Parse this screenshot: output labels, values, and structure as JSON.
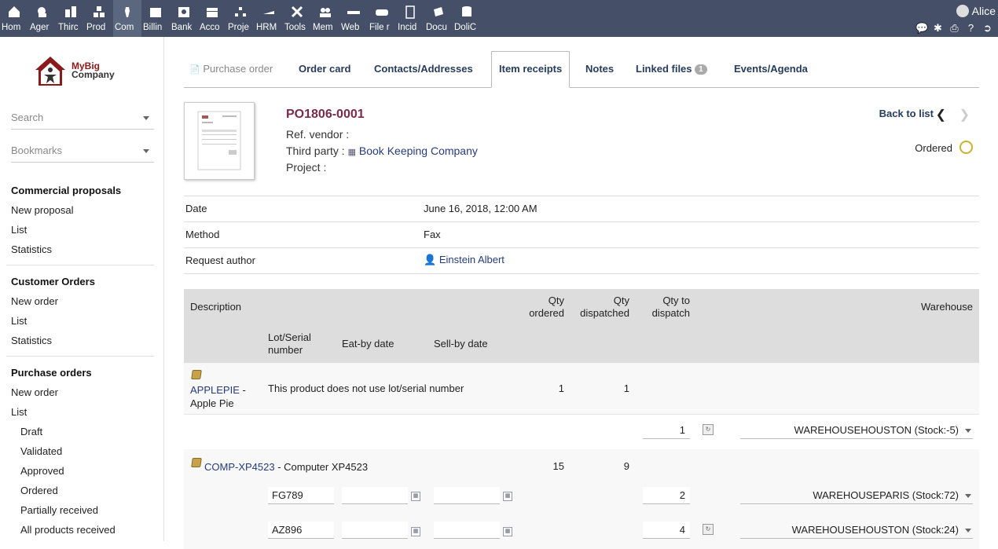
{
  "topmenu": {
    "items": [
      {
        "label": "Hom"
      },
      {
        "label": "Ager"
      },
      {
        "label": "Thirc"
      },
      {
        "label": "Prod"
      },
      {
        "label": "Com"
      },
      {
        "label": "Billin"
      },
      {
        "label": "Bank"
      },
      {
        "label": "Acco"
      },
      {
        "label": "Proje"
      },
      {
        "label": "HRM"
      },
      {
        "label": "Tools"
      },
      {
        "label": "Mem"
      },
      {
        "label": "Web"
      },
      {
        "label": "File r"
      },
      {
        "label": "Incid"
      },
      {
        "label": "Docu"
      },
      {
        "label": "DoliC"
      }
    ],
    "active_index": 4,
    "user": "Alice"
  },
  "sidebar": {
    "logo_line1": "MyBig",
    "logo_line2": "Company",
    "search_placeholder": "Search",
    "bookmarks_placeholder": "Bookmarks",
    "sections": [
      {
        "title": "Commercial proposals",
        "links": [
          "New proposal",
          "List",
          "Statistics"
        ]
      },
      {
        "title": "Customer Orders",
        "links": [
          "New order",
          "List",
          "Statistics"
        ]
      },
      {
        "title": "Purchase orders",
        "links": [
          "New order",
          "List"
        ],
        "sublinks": [
          "Draft",
          "Validated",
          "Approved",
          "Ordered",
          "Partially received",
          "All products received"
        ]
      }
    ]
  },
  "tabs": {
    "first": "Purchase order",
    "items": [
      "Order card",
      "Contacts/Addresses",
      "Item receipts",
      "Notes",
      "Linked files",
      "Events/Agenda"
    ],
    "linked_files_count": "1",
    "active": "Item receipts"
  },
  "header": {
    "ref": "PO1806-0001",
    "ref_vendor_label": "Ref. vendor :",
    "third_party_label": "Third party :",
    "third_party": "Book Keeping Company",
    "project_label": "Project :",
    "back_to_list": "Back to list",
    "status": "Ordered"
  },
  "info": {
    "date_label": "Date",
    "date_value": "June 16, 2018, 12:00 AM",
    "method_label": "Method",
    "method_value": "Fax",
    "author_label": "Request author",
    "author_value": "Einstein Albert"
  },
  "table": {
    "headers": {
      "description": "Description",
      "qty_ordered_1": "Qty",
      "qty_ordered_2": "ordered",
      "qty_dispatched_1": "Qty",
      "qty_dispatched_2": "dispatched",
      "qty_to_dispatch_1": "Qty to",
      "qty_to_dispatch_2": "dispatch",
      "warehouse": "Warehouse",
      "lot_1": "Lot/Serial",
      "lot_2": "number",
      "eatby": "Eat-by date",
      "sellby": "Sell-by date"
    },
    "rows": [
      {
        "product_ref": "APPLEPIE",
        "product_sep": " -",
        "product_label": "Apple Pie",
        "note": "This product does not use lot/serial number",
        "qty_ordered": "1",
        "qty_dispatched": "1",
        "lines": [
          {
            "qty": "1",
            "warehouse": "WAREHOUSEHOUSTON (Stock:-5)"
          }
        ]
      },
      {
        "product_ref": "COMP-XP4523",
        "product_label": " - Computer XP4523",
        "qty_ordered": "15",
        "qty_dispatched": "9",
        "lines": [
          {
            "lot": "FG789",
            "qty": "2",
            "warehouse": "WAREHOUSEPARIS (Stock:72)"
          },
          {
            "lot": "AZ896",
            "qty": "4",
            "warehouse": "WAREHOUSEHOUSTON (Stock:24)"
          }
        ]
      }
    ]
  }
}
